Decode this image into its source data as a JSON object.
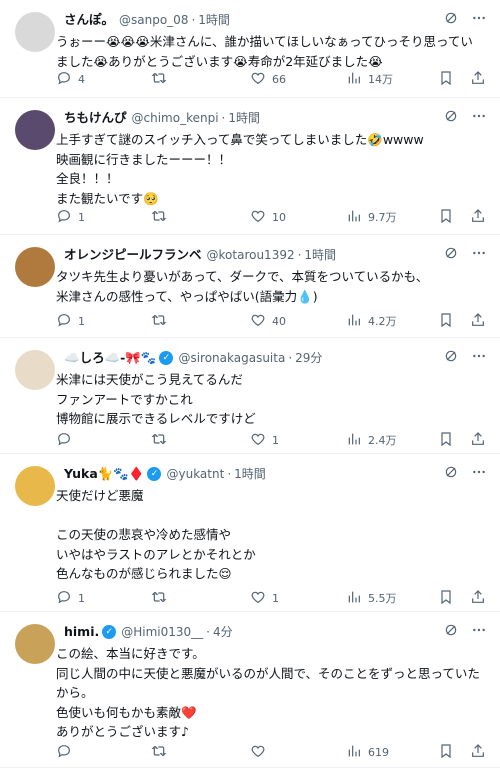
{
  "tweets": [
    {
      "name": "さんぽ。",
      "handle": "@sanpo_08",
      "time": "1時間",
      "avatar_color": "#d9d9d9",
      "lines": [
        "うぉーー😭😭😭米津さんに、誰か描いてほしいなぁってひっそり思ってい",
        "ました😭ありがとうございます😭寿命が2年延びました😭"
      ],
      "reply_count": "4",
      "retweet_count": "",
      "like_count": "66",
      "view_count": "14万"
    },
    {
      "name": "ちもけんぴ",
      "handle": "@chimo_kenpi",
      "time": "1時間",
      "avatar_color": "#5a4a6e",
      "lines": [
        "上手すぎて謎のスイッチ入って鼻で笑ってしまいました🤣wwww",
        "映画観に行きましたーーー！！",
        "全良！！！",
        "また観たいです🥺"
      ],
      "reply_count": "1",
      "retweet_count": "",
      "like_count": "10",
      "view_count": "9.7万"
    },
    {
      "name": "オレンジピールフランベ",
      "handle": "@kotarou1392",
      "time": "1時間",
      "avatar_color": "#b07a3f",
      "lines": [
        "タツキ先生より憂いがあって、ダークで、本質をついているかも、",
        "米津さんの感性って、やっぱやばい(語彙力💧)"
      ],
      "reply_count": "1",
      "retweet_count": "",
      "like_count": "40",
      "view_count": "4.2万"
    },
    {
      "name": "☁️しろ☁️-🎀🐾",
      "handle": "@sironakagasuita",
      "time": "29分",
      "avatar_color": "#e8dcc8",
      "lines": [
        "米津には天使がこう見えてるんだ",
        "ファンアートですかこれ",
        "博物館に展示できるレベルですけど"
      ],
      "reply_count": "",
      "retweet_count": "",
      "like_count": "1",
      "view_count": "2.4万"
    },
    {
      "name": "Yuka🐈🐾♦️",
      "handle": "@yukatnt",
      "time": "1時間",
      "avatar_color": "#e8b84a",
      "lines": [
        "天使だけど悪魔",
        "",
        "この天使の悲哀や冷めた感情や",
        "いやはやラストのアレとかそれとか",
        "色んなものが感じられました😌"
      ],
      "reply_count": "1",
      "retweet_count": "",
      "like_count": "1",
      "view_count": "5.5万"
    },
    {
      "name": "himi.",
      "handle": "@Himi0130__",
      "time": "4分",
      "avatar_color": "#c9a25a",
      "lines": [
        "この絵、本当に好きです。",
        "同じ人間の中に天使と悪魔がいるのが人間で、そのことをずっと思っていた",
        "から。",
        "色使いも何もかも素敵❤️",
        "ありがとうございます♪"
      ],
      "reply_count": "",
      "retweet_count": "",
      "like_count": "",
      "view_count": "619"
    }
  ]
}
